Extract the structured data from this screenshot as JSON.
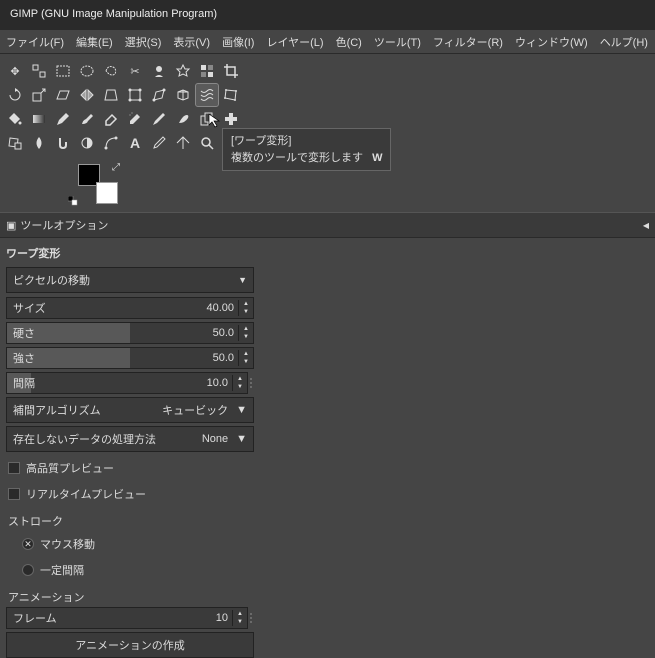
{
  "title": "GIMP (GNU Image Manipulation Program)",
  "menu": [
    "ファイル(F)",
    "編集(E)",
    "選択(S)",
    "表示(V)",
    "画像(I)",
    "レイヤー(L)",
    "色(C)",
    "ツール(T)",
    "フィルター(R)",
    "ウィンドウ(W)",
    "ヘルプ(H)"
  ],
  "tooltip": {
    "title": "[ワープ変形]",
    "desc": "複数のツールで変形します",
    "key": "W"
  },
  "panel_title": "ツールオプション",
  "options": {
    "tool_name": "ワープ変形",
    "mode_label": "ピクセルの移動",
    "size_label": "サイズ",
    "size_val": "40.00",
    "hardness_label": "硬さ",
    "hardness_val": "50.0",
    "strength_label": "強さ",
    "strength_val": "50.0",
    "spacing_label": "間隔",
    "spacing_val": "10.0",
    "interp_label": "補間アルゴリズム",
    "interp_val": "キュービック",
    "abyss_label": "存在しないデータの処理方法",
    "abyss_val": "None",
    "hq_preview": "高品質プレビュー",
    "rt_preview": "リアルタイムプレビュー",
    "stroke_header": "ストローク",
    "mouse_move": "マウス移動",
    "fixed_spacing": "一定間隔",
    "animation_header": "アニメーション",
    "frames_label": "フレーム",
    "frames_val": "10",
    "create_animation": "アニメーションの作成"
  },
  "colors": {
    "fg": "#000000",
    "bg": "#ffffff"
  }
}
